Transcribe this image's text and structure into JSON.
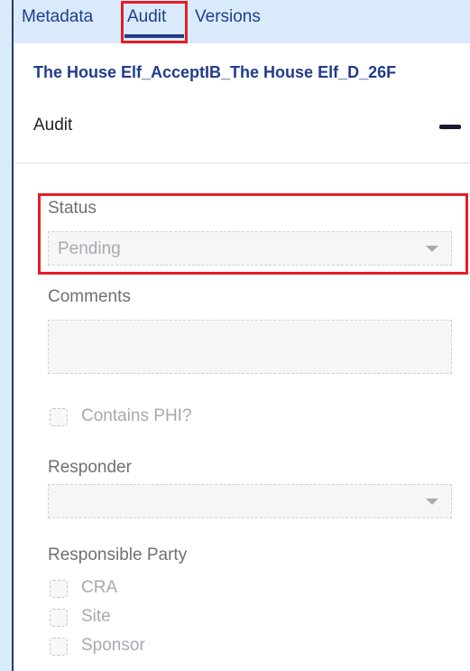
{
  "tabs": {
    "metadata": "Metadata",
    "audit": "Audit",
    "versions": "Versions",
    "active": "Audit"
  },
  "document": {
    "title": "The House Elf_AcceptIB_The House Elf_D_26F"
  },
  "section": {
    "title": "Audit",
    "collapse_icon": "minus-icon"
  },
  "form": {
    "status": {
      "label": "Status",
      "value": "Pending"
    },
    "comments": {
      "label": "Comments",
      "value": ""
    },
    "contains_phi": {
      "label": "Contains PHI?",
      "checked": false
    },
    "responder": {
      "label": "Responder",
      "value": ""
    },
    "responsible_party": {
      "label": "Responsible Party",
      "options": [
        {
          "label": "CRA",
          "checked": false
        },
        {
          "label": "Site",
          "checked": false
        },
        {
          "label": "Sponsor",
          "checked": false
        }
      ]
    }
  },
  "colors": {
    "tab_text": "#223c8a",
    "highlight": "#e41e26",
    "background": "#d9ebfb"
  }
}
